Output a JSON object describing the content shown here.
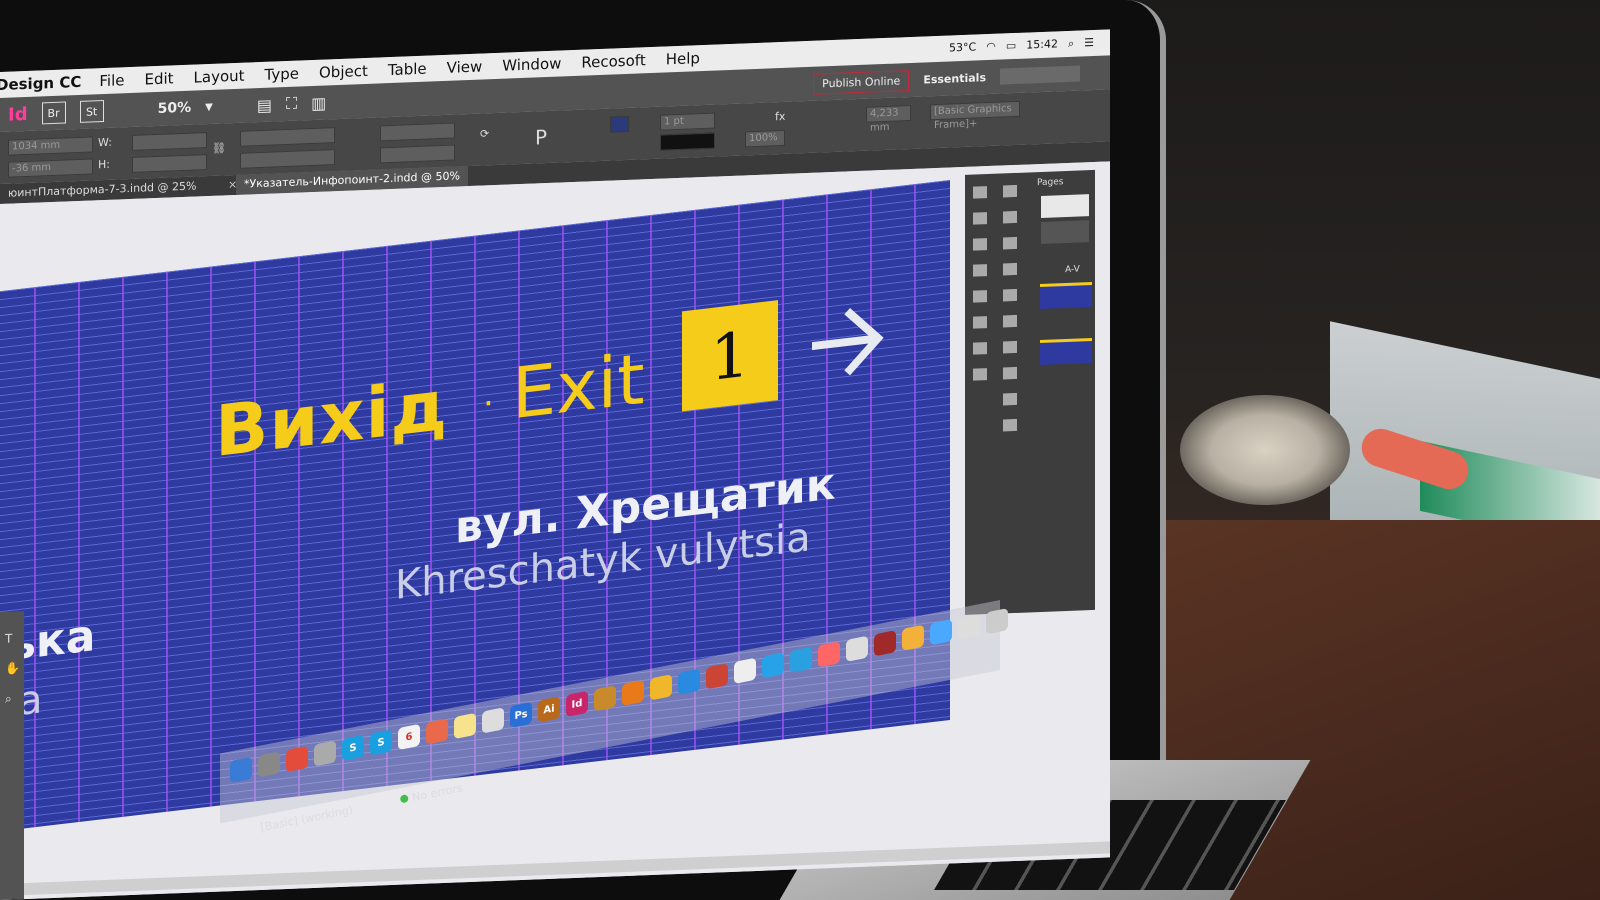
{
  "menubar": {
    "app_name": "Design CC",
    "items": [
      "File",
      "Edit",
      "Layout",
      "Type",
      "Object",
      "Table",
      "View",
      "Window",
      "Recosoft",
      "Help"
    ],
    "clock": "15:42",
    "temp": "53°C"
  },
  "appbar": {
    "badge": "Id",
    "bridge": "Br",
    "stock": "St",
    "zoom": "50%",
    "publish": "Publish Online",
    "workspace": "Essentials"
  },
  "control": {
    "x_value": "1034 mm",
    "y_value": "-36 mm",
    "w_label": "W:",
    "h_label": "H:",
    "stroke": "1 pt",
    "opacity": "100%",
    "frame_style": "[Basic Graphics Frame]+",
    "width_field": "4,233 mm"
  },
  "tabs": [
    {
      "label": "юинтПлатформа-7-3.indd @ 25%"
    },
    {
      "label": "*Указатель-Инфопоинт-2.indd @ 50%"
    }
  ],
  "sign": {
    "title_ua": "Вихід",
    "separator": "·",
    "title_en": "Exit",
    "exit_number": "1",
    "street_ua": "вул. Хрещатик",
    "street_en": "Khreschatyk vulytsia",
    "left_ua": "ська",
    "left_en": "sia"
  },
  "panel": {
    "pages_label": "Pages",
    "spread_label": "A-V"
  },
  "status": {
    "preflight_profile": "[Basic] (working)",
    "preflight": "No errors"
  },
  "colors": {
    "sign_bg": "#2f3aa0",
    "accent_yellow": "#f5cc1a",
    "indesign_pink": "#ff3d9a"
  }
}
